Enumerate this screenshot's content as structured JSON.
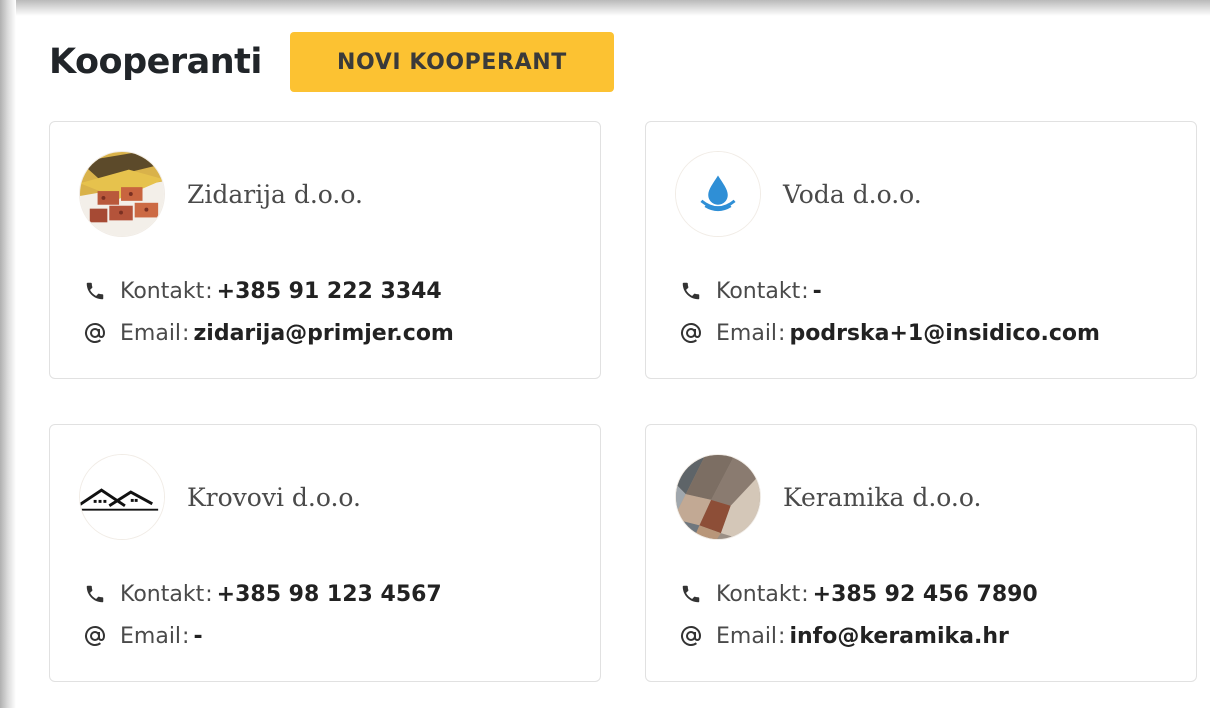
{
  "header": {
    "title": "Kooperanti",
    "new_button": "NOVI KOOPERANT"
  },
  "labels": {
    "contact": "Kontakt",
    "email": "Email",
    "sep": ":"
  },
  "colors": {
    "accent": "#fcc232"
  },
  "partners": [
    {
      "name": "Zidarija d.o.o.",
      "phone": "+385 91 222 3344",
      "email": "zidarija@primjer.com",
      "avatar": "bricks-image"
    },
    {
      "name": "Voda d.o.o.",
      "phone": "-",
      "email": "podrska+1@insidico.com",
      "avatar": "water-drop-icon"
    },
    {
      "name": "Krovovi d.o.o.",
      "phone": "+385 98 123 4567",
      "email": "-",
      "avatar": "roofs-icon"
    },
    {
      "name": "Keramika d.o.o.",
      "phone": "+385 92 456 7890",
      "email": "info@keramika.hr",
      "avatar": "tiles-image"
    }
  ]
}
